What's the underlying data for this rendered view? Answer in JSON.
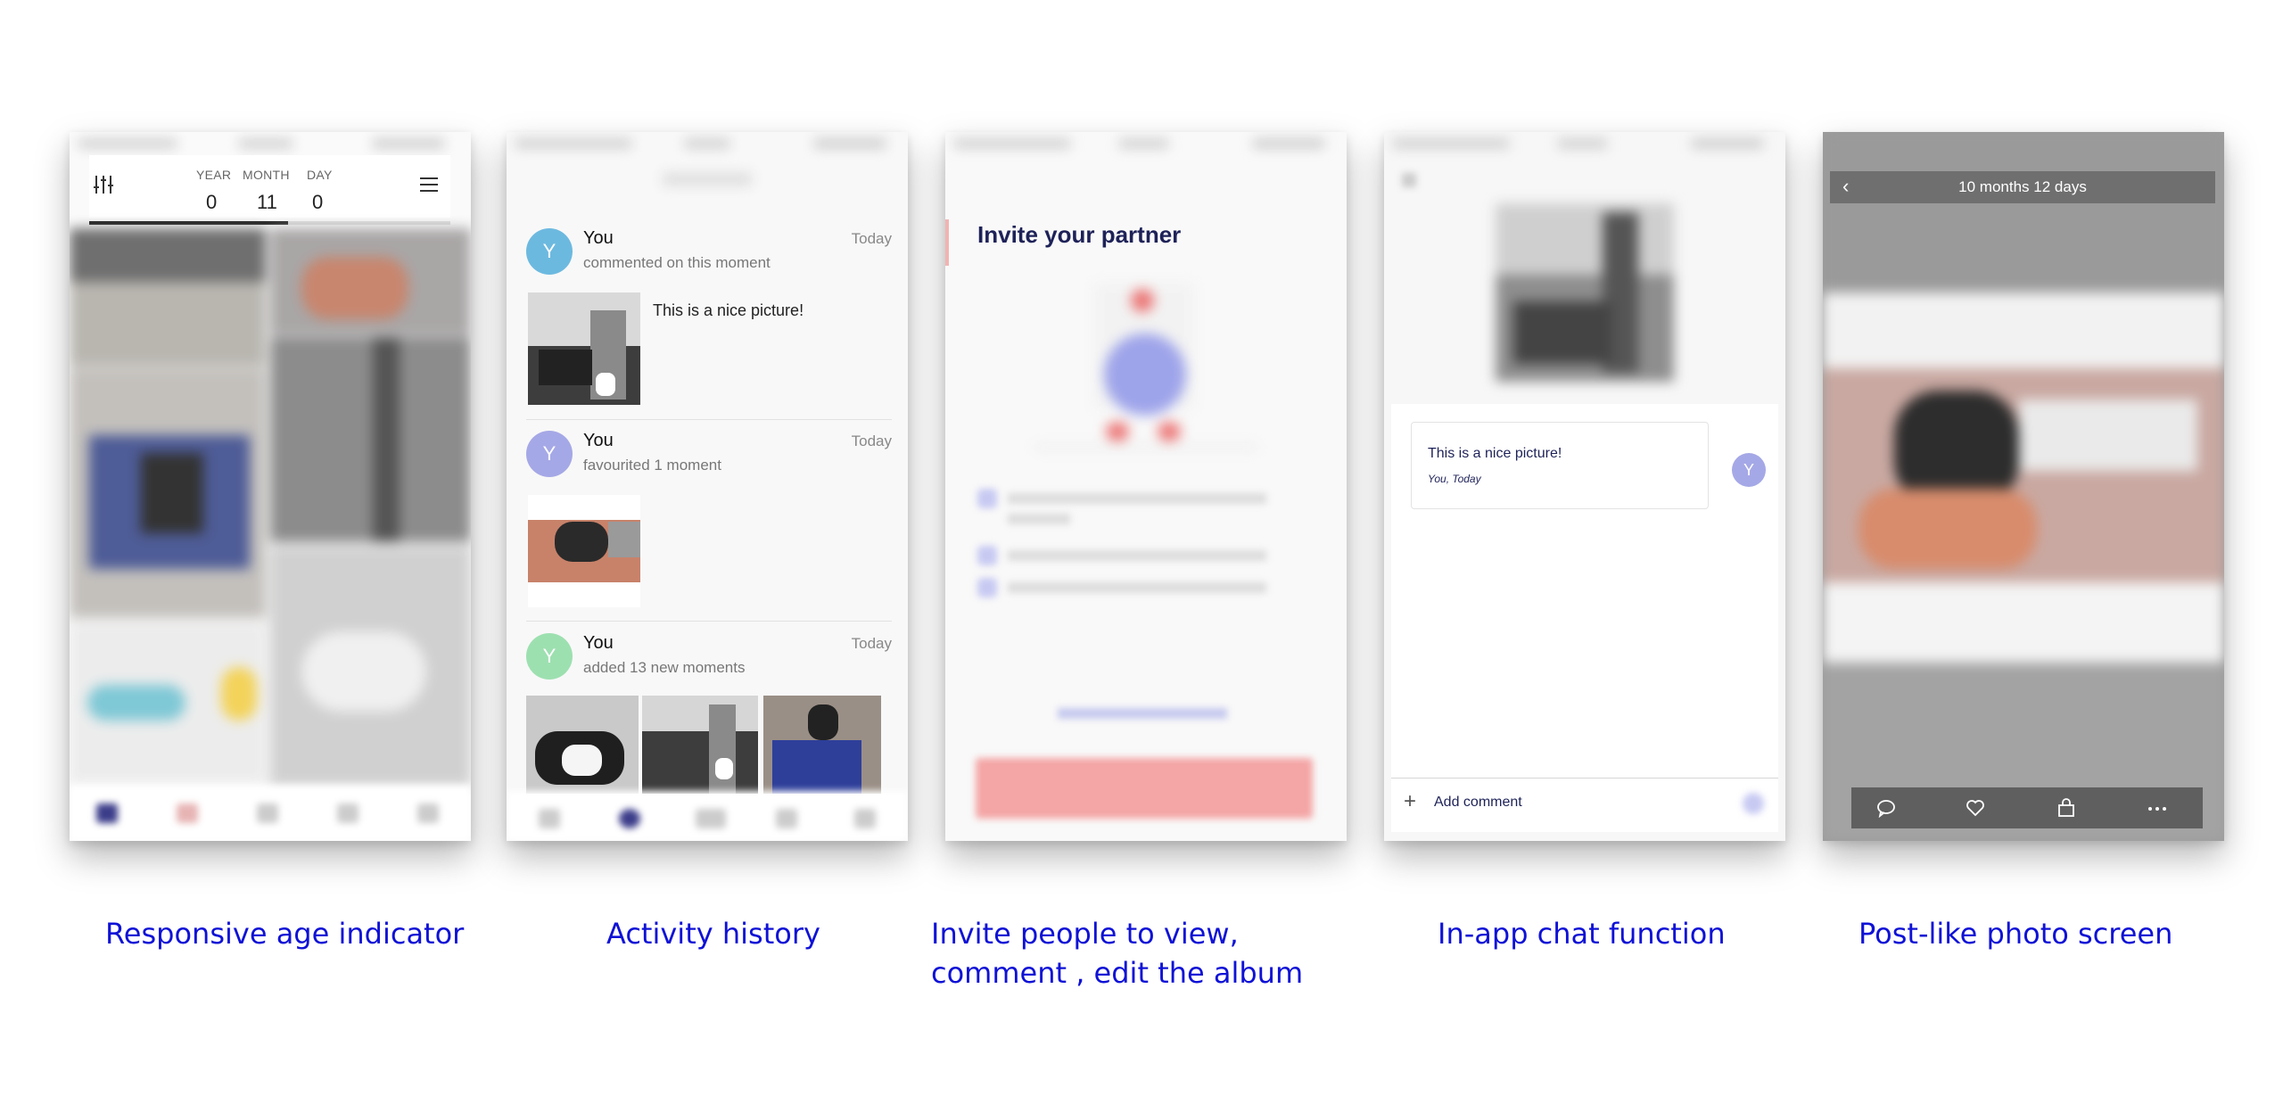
{
  "captions": [
    "Responsive age indicator",
    "Activity history",
    "Invite people to view,",
    "comment , edit the album",
    "In-app chat function",
    "Post-like photo screen"
  ],
  "age_indicator": {
    "year_label": "YEAR",
    "month_label": "MONTH",
    "day_label": "DAY",
    "year_value": "0",
    "month_value": "11",
    "day_value": "0"
  },
  "activity": {
    "items": [
      {
        "avatar": "Y",
        "name": "You",
        "action": "commented on this moment",
        "time": "Today",
        "comment": "This is a nice picture!"
      },
      {
        "avatar": "Y",
        "name": "You",
        "action": "favourited 1 moment",
        "time": "Today"
      },
      {
        "avatar": "Y",
        "name": "You",
        "action": "added 13 new moments",
        "time": "Today"
      }
    ]
  },
  "invite": {
    "title": "Invite your partner"
  },
  "chat": {
    "message": "This is a nice picture!",
    "meta": "You, Today",
    "avatar": "Y",
    "add_comment": "Add comment"
  },
  "photo": {
    "title": "10 months 12 days"
  },
  "colors": {
    "caption": "#0f12d6",
    "avatar_blue": "#6cb9e0",
    "avatar_purple": "#a5a8e6",
    "avatar_green": "#9de0b0",
    "invite_title": "#1e2258"
  }
}
